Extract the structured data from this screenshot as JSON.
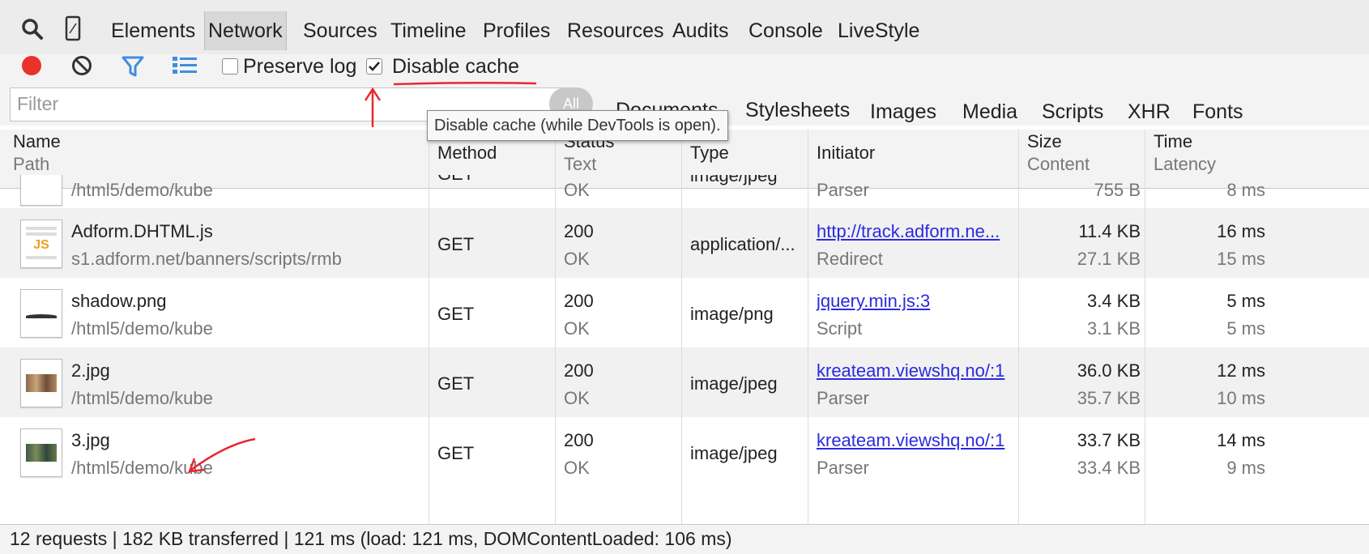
{
  "panel_tabs": [
    "Elements",
    "Network",
    "Sources",
    "Timeline",
    "Profiles",
    "Resources",
    "Audits",
    "Console",
    "LiveStyle"
  ],
  "active_tab": "Network",
  "toolbar": {
    "preserve_log_label": "Preserve log",
    "preserve_log_checked": false,
    "disable_cache_label": "Disable cache",
    "disable_cache_checked": true
  },
  "filter": {
    "placeholder": "Filter",
    "all_label": "All",
    "type_filters": [
      "Documents",
      "Stylesheets",
      "Images",
      "Media",
      "Scripts",
      "XHR",
      "Fonts"
    ]
  },
  "tooltip": "Disable cache (while DevTools is open).",
  "columns": {
    "name": "Name",
    "path": "Path",
    "method": "Method",
    "status": "Status",
    "text": "Text",
    "type": "Type",
    "initiator": "Initiator",
    "size": "Size",
    "content": "Content",
    "time": "Time",
    "latency": "Latency"
  },
  "rows": [
    {
      "name": "",
      "path": "/html5/demo/kube",
      "method": "GET",
      "status": "",
      "text": "OK",
      "type": "image/jpeg",
      "initiator": "",
      "initiator_sub": "Parser",
      "size": "",
      "content": "755 B",
      "time": "",
      "latency": "8 ms"
    },
    {
      "name": "Adform.DHTML.js",
      "path": "s1.adform.net/banners/scripts/rmb",
      "method": "GET",
      "status": "200",
      "text": "OK",
      "type": "application/...",
      "initiator": "http://track.adform.ne...",
      "initiator_sub": "Redirect",
      "size": "11.4 KB",
      "content": "27.1 KB",
      "time": "16 ms",
      "latency": "15 ms"
    },
    {
      "name": "shadow.png",
      "path": "/html5/demo/kube",
      "method": "GET",
      "status": "200",
      "text": "OK",
      "type": "image/png",
      "initiator": "jquery.min.js:3",
      "initiator_sub": "Script",
      "size": "3.4 KB",
      "content": "3.1 KB",
      "time": "5 ms",
      "latency": "5 ms"
    },
    {
      "name": "2.jpg",
      "path": "/html5/demo/kube",
      "method": "GET",
      "status": "200",
      "text": "OK",
      "type": "image/jpeg",
      "initiator": "kreateam.viewshq.no/:1",
      "initiator_sub": "Parser",
      "size": "36.0 KB",
      "content": "35.7 KB",
      "time": "12 ms",
      "latency": "10 ms"
    },
    {
      "name": "3.jpg",
      "path": "/html5/demo/kube",
      "method": "GET",
      "status": "200",
      "text": "OK",
      "type": "image/jpeg",
      "initiator": "kreateam.viewshq.no/:1",
      "initiator_sub": "Parser",
      "size": "33.7 KB",
      "content": "33.4 KB",
      "time": "14 ms",
      "latency": "9 ms"
    }
  ],
  "thumb_labels": {
    "js": "JS"
  },
  "status_bar": "12 requests | 182 KB transferred | 121 ms (load: 121 ms, DOMContentLoaded: 106 ms)",
  "icons": [
    "search-icon",
    "device-mode-icon",
    "record-icon",
    "clear-icon",
    "filter-icon",
    "list-view-icon"
  ],
  "colors": {
    "record": "#e8322a",
    "filter_icon": "#3f8ee0",
    "link": "#2a2ae0",
    "annotation": "#e8282e"
  }
}
